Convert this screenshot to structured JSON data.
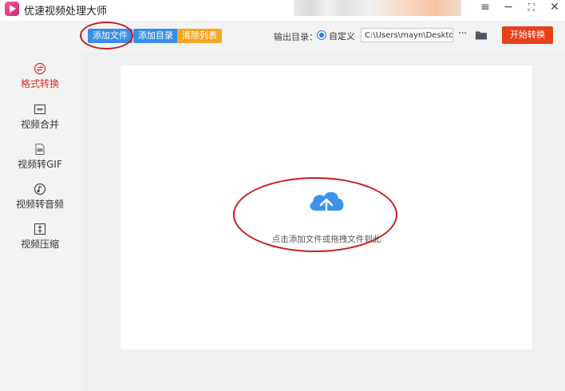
{
  "app": {
    "title": "优速视频处理大师"
  },
  "window_controls": {
    "menu": "≡",
    "minimize": "−",
    "maximize": "⛶",
    "close": "✕"
  },
  "sidebar": {
    "items": [
      {
        "label": "格式转换",
        "icon": "format-convert-icon",
        "active": true
      },
      {
        "label": "视频合并",
        "icon": "video-merge-icon",
        "active": false
      },
      {
        "label": "视频转GIF",
        "icon": "gif-icon",
        "active": false
      },
      {
        "label": "视频转音频",
        "icon": "audio-icon",
        "active": false
      },
      {
        "label": "视频压缩",
        "icon": "compress-icon",
        "active": false
      }
    ]
  },
  "toolbar": {
    "add_file": "添加文件",
    "add_dir": "添加目录",
    "clear_list": "清除列表",
    "output_label": "输出目录：",
    "radio_custom": "自定义",
    "output_path": "C:\\Users\\mayn\\Desktop",
    "more": "···",
    "start": "开始转换"
  },
  "main": {
    "drop_hint": "点击添加文件或拖拽文件到此"
  },
  "colors": {
    "active": "#d92b28",
    "blue_button": "#3a8ee6",
    "orange_button": "#f5a623",
    "start_button": "#e8401c",
    "annotation": "#c81e1e"
  }
}
